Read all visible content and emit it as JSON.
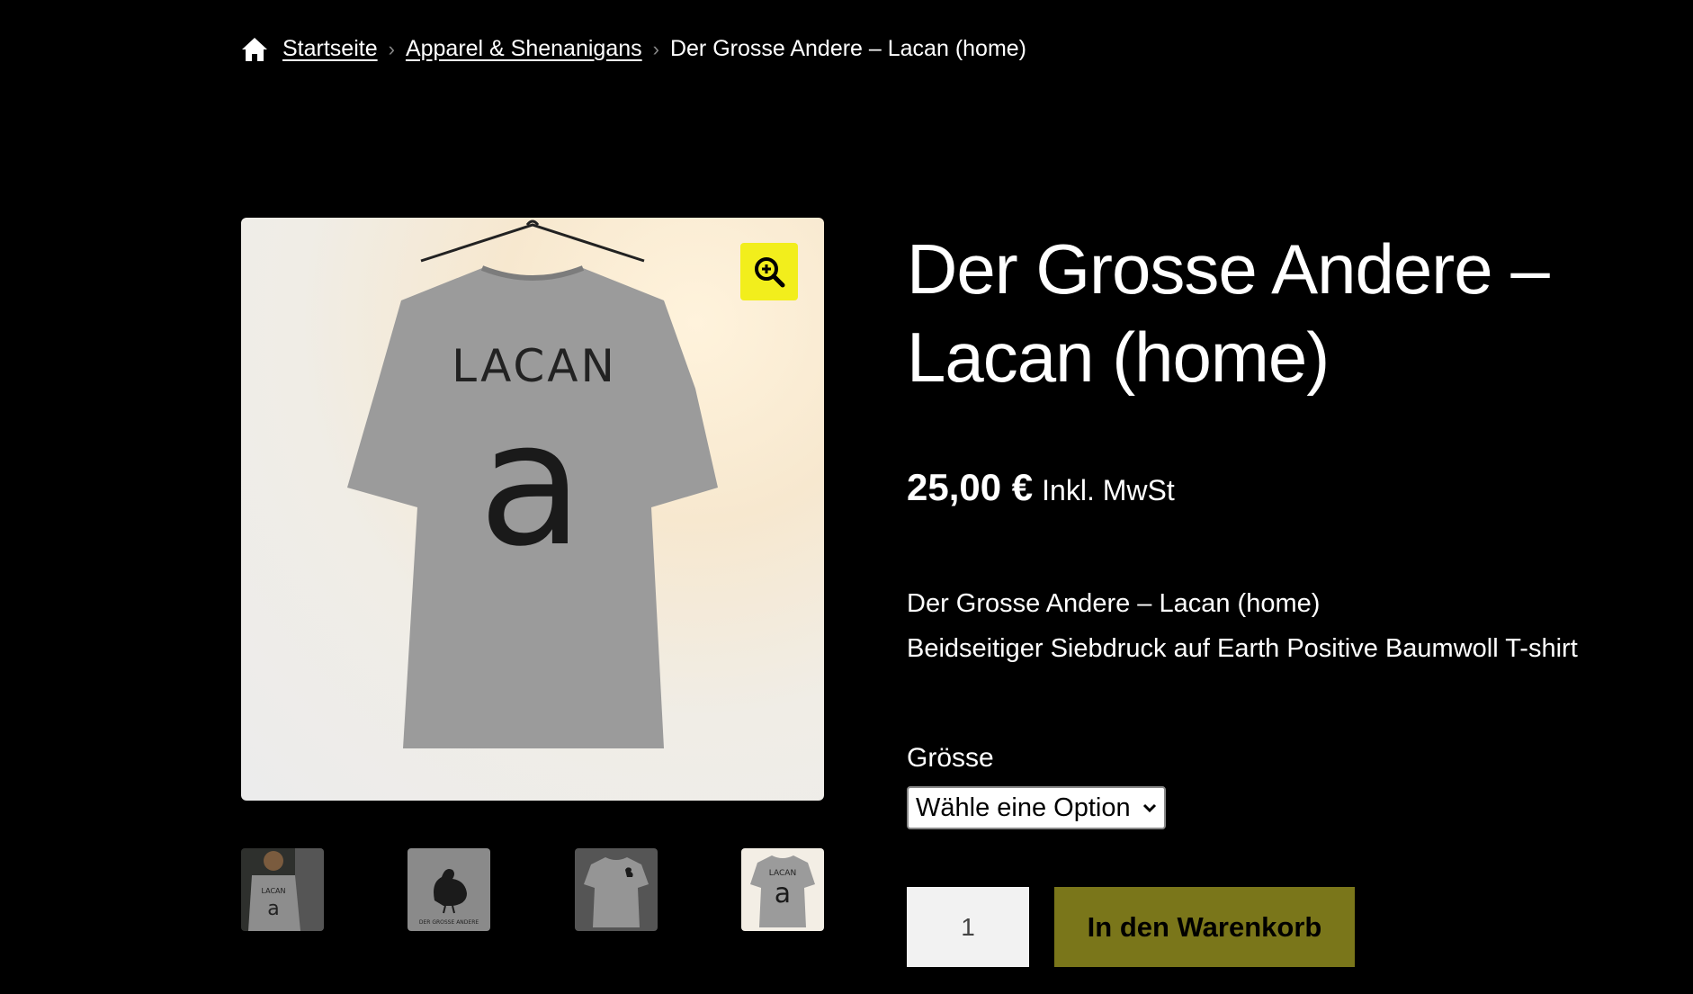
{
  "breadcrumb": {
    "home_icon": "home-icon",
    "items": [
      "Startseite",
      "Apparel & Shenanigans"
    ],
    "current": "Der Grosse Andere – Lacan (home)"
  },
  "product": {
    "title": "Der Grosse Andere – Lacan (home)",
    "price": "25,00 €",
    "tax_note": "Inkl. MwSt",
    "description": [
      "Der Grosse Andere – Lacan (home)",
      "Beidseitiger Siebdruck auf Earth Positive Baumwoll T-shirt"
    ],
    "size_label": "Grösse",
    "size_select": "Wähle eine Option",
    "quantity": "1",
    "add_to_cart": "In den Warenkorb",
    "shirt_print": {
      "top": "LACAN",
      "letter": "a"
    },
    "thumb_print": "DER GROSSE ANDERE"
  },
  "colors": {
    "zoom_button": "#f2ee1c",
    "cart_button": "#7a761a",
    "background": "#000000"
  }
}
